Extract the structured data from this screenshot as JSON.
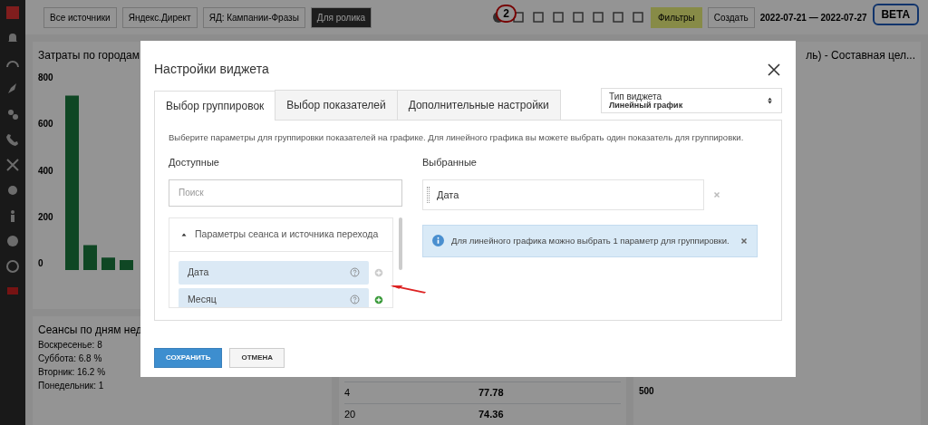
{
  "background": {
    "toolbar_buttons": [
      {
        "label": "Все источники",
        "selected": false
      },
      {
        "label": "Яндекс.Директ",
        "selected": false
      },
      {
        "label": "ЯД: Кампании-Фразы",
        "selected": false
      },
      {
        "label": "Для ролика",
        "selected": true
      }
    ],
    "notification_count": "2",
    "filters_label": "Фильтры",
    "create_label": "Создать",
    "date_range": "2022-07-21 — 2022-07-27",
    "beta_badge": "BETA",
    "chart_title": "Затраты по городам",
    "axis_ticks": [
      "800",
      "600",
      "400",
      "200",
      "0"
    ],
    "pie_title": "Сеансы по дням нед",
    "pie_labels": [
      "Воскресенье: 8",
      "Суббота: 6.8 %",
      "Вторник: 16.2 %",
      "Понедельник: 1"
    ],
    "right_title": "ль) - Составная цел...",
    "table_rows": [
      [
        "4",
        "77.78"
      ],
      [
        "20",
        "74.36"
      ]
    ],
    "right_tick": "500"
  },
  "modal": {
    "title": "Настройки виджета",
    "tabs": [
      {
        "label": "Выбор группировок",
        "selected": true
      },
      {
        "label": "Выбор показателей",
        "selected": false
      },
      {
        "label": "Дополнительные настройки",
        "selected": false
      }
    ],
    "widget_type": {
      "label": "Тип виджета",
      "value": "Линейный график"
    },
    "description": "Выберите параметры для группировки показателей на графике. Для линейного графика вы можете выбрать один показатель для группировки.",
    "available": {
      "heading": "Доступные",
      "search_placeholder": "Поиск",
      "groups": [
        {
          "label": "Параметры сеанса и источника перехода",
          "expanded": true,
          "items": [
            {
              "label": "Дата",
              "addable": false
            },
            {
              "label": "Месяц",
              "addable": true
            }
          ]
        }
      ]
    },
    "chosen": {
      "heading": "Выбранные",
      "items": [
        {
          "label": "Дата"
        }
      ]
    },
    "alert": "Для линейного графика можно выбрать 1 параметр для группировки.",
    "buttons": [
      {
        "label": "СОХРАНИТЬ",
        "kind": "primary"
      },
      {
        "label": "ОТМЕНА",
        "kind": "secondary"
      }
    ]
  }
}
